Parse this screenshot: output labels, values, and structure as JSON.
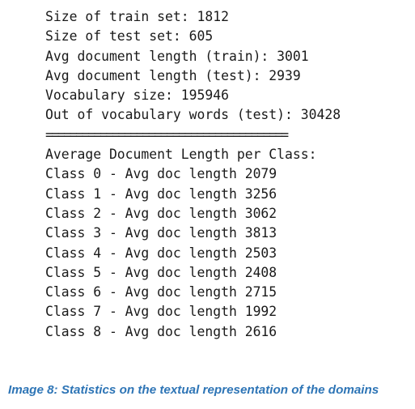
{
  "stats": {
    "train_size": "Size of train set: 1812",
    "test_size": "Size of test set: 605",
    "avg_len_train": "Avg document length (train): 3001",
    "avg_len_test": "Avg document length (test): 2939",
    "vocab_size": "Vocabulary size: 195946",
    "oov_test": "Out of vocabulary words (test): 30428"
  },
  "separator": "========================================",
  "per_class": {
    "heading": "Average Document Length per Class:",
    "rows": [
      "Class 0 - Avg doc length 2079",
      "Class 1 - Avg doc length 3256",
      "Class 2 - Avg doc length 3062",
      "Class 3 - Avg doc length 3813",
      "Class 4 - Avg doc length 2503",
      "Class 5 - Avg doc length 2408",
      "Class 6 - Avg doc length 2715",
      "Class 7 - Avg doc length 1992",
      "Class 8 - Avg doc length 2616"
    ]
  },
  "caption": "Image 8: Statistics on the textual representation of the domains",
  "colors": {
    "text": "#1a1a1a",
    "caption": "#2e75b6",
    "background": "#ffffff"
  }
}
